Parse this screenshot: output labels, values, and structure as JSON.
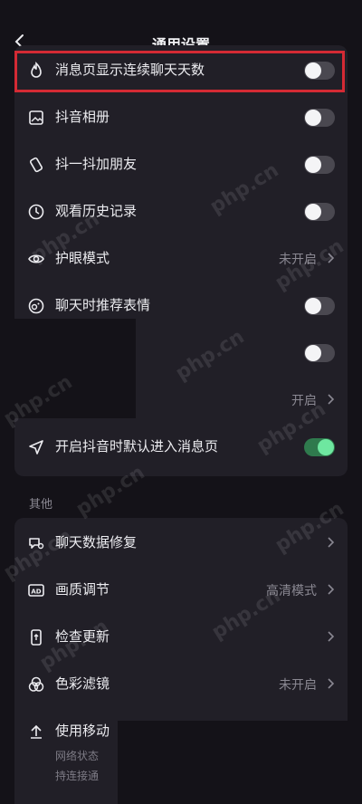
{
  "header": {
    "title": "通用设置"
  },
  "rows": [
    {
      "label": "消息页显示连续聊天天数",
      "icon": "flame-icon",
      "toggle": "off"
    },
    {
      "label": "抖音相册",
      "icon": "image-icon",
      "toggle": "off"
    },
    {
      "label": "抖一抖加朋友",
      "icon": "shake-icon",
      "toggle": "off"
    },
    {
      "label": "观看历史记录",
      "icon": "clock-icon",
      "toggle": "off"
    },
    {
      "label": "护眼模式",
      "icon": "eye-icon",
      "value": "未开启"
    },
    {
      "label": "聊天时推荐表情",
      "icon": "emoji-icon",
      "toggle": "off"
    },
    {
      "toggle": "off"
    },
    {
      "value": "开启"
    },
    {
      "label": "开启抖音时默认进入消息页",
      "icon": "send-icon",
      "toggle": "on"
    }
  ],
  "section_other": "其他",
  "other_rows": [
    {
      "label": "聊天数据修复",
      "icon": "chat-repair-icon"
    },
    {
      "label": "画质调节",
      "icon": "ad-icon",
      "value": "高清模式"
    },
    {
      "label": "检查更新",
      "icon": "phone-update-icon"
    },
    {
      "label": "色彩滤镜",
      "icon": "color-filter-icon",
      "value": "未开启"
    },
    {
      "label": "使用移动",
      "icon": "upload-icon",
      "sub1": "网络状态",
      "sub2": "持连接通"
    }
  ],
  "watermark": "php.cn",
  "colors": {
    "background": "#141218",
    "card": "#211f27",
    "highlight": "#d42a34",
    "toggle_on": "#6ee7a0"
  }
}
